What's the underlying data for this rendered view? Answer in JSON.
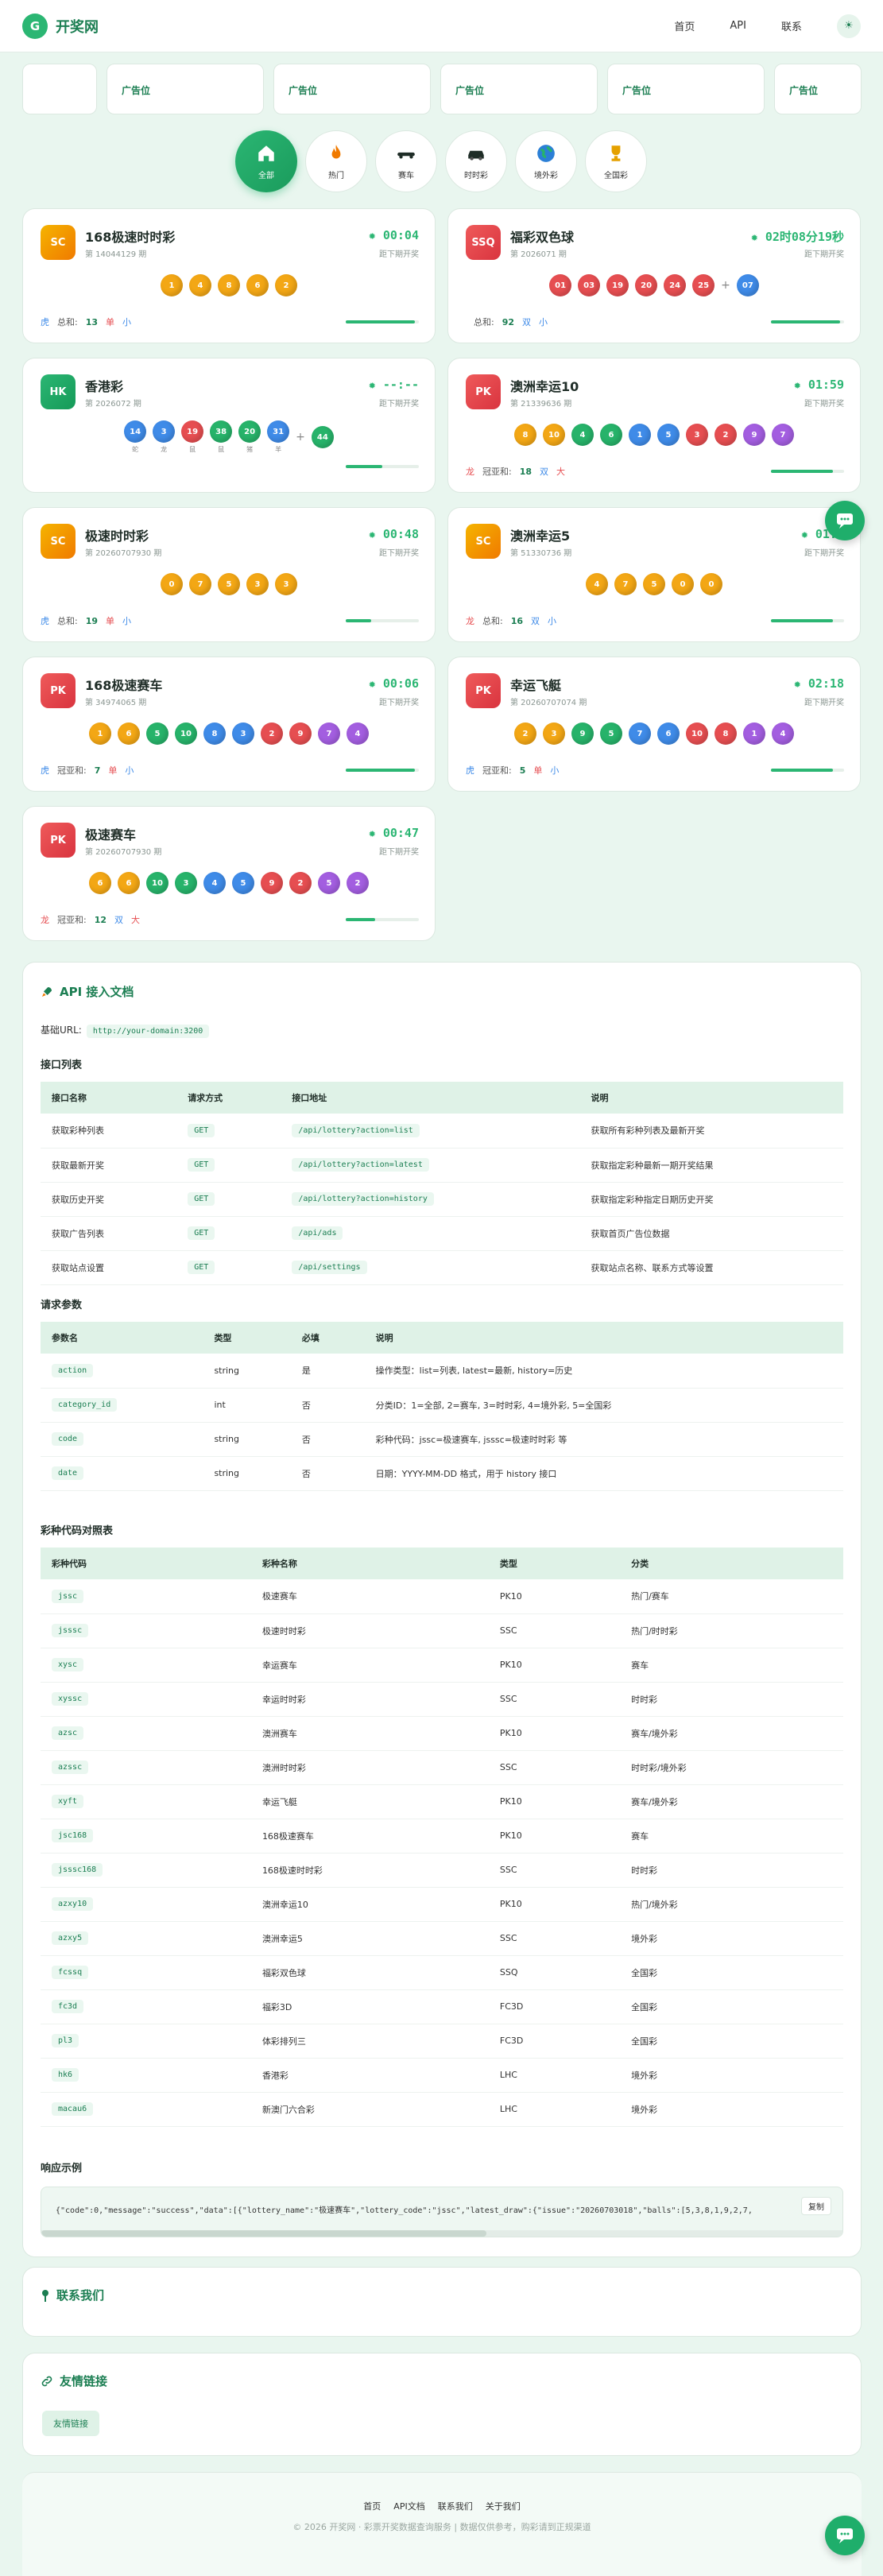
{
  "header": {
    "logo_letter": "G",
    "title": "开奖网",
    "nav": [
      "首页",
      "API",
      "联系"
    ],
    "theme_icon": "☀"
  },
  "ads": [
    "",
    "广告位",
    "广告位",
    "广告位",
    "广告位",
    "广告位"
  ],
  "categories": [
    {
      "label": "全部",
      "icon": "home-icon"
    },
    {
      "label": "热门",
      "icon": "fire-icon"
    },
    {
      "label": "赛车",
      "icon": "race-car-icon"
    },
    {
      "label": "时时彩",
      "icon": "car-icon"
    },
    {
      "label": "境外彩",
      "icon": "globe-icon"
    },
    {
      "label": "全国彩",
      "icon": "trophy-icon"
    }
  ],
  "cards": [
    {
      "badge": "SC",
      "name": "168极速时时彩",
      "issue": "第 14044129 期",
      "timer": "00:04",
      "sub": "距下期开奖",
      "balls": [
        "1",
        "4",
        "8",
        "6",
        "2"
      ],
      "colors": [
        "bo",
        "bo",
        "bo",
        "bo",
        "bo"
      ],
      "f1": "虎",
      "f2": "总和:",
      "f3": "13",
      "f4": "单",
      "f5": "小",
      "progress": 0.95
    },
    {
      "badge": "SSQ",
      "name": "福彩双色球",
      "issue": "第 2026071 期",
      "timer": "02时08分19秒",
      "sub": "距下期开奖",
      "balls": [
        "01",
        "03",
        "19",
        "20",
        "24",
        "25",
        "+",
        "07"
      ],
      "colors": [
        "br",
        "br",
        "br",
        "br",
        "br",
        "br",
        "",
        "bb"
      ],
      "f1": "",
      "f2": "总和:",
      "f3": "92",
      "f4": "双",
      "f5": "小",
      "progress": 0.95
    },
    {
      "badge": "HK",
      "name": "香港彩",
      "issue": "第 2026072 期",
      "timer": "--:--",
      "sub": "距下期开奖",
      "balls": [
        "14",
        "3",
        "19",
        "38",
        "20",
        "31",
        "+",
        "44"
      ],
      "colors": [
        "bb",
        "bb",
        "br",
        "bg",
        "bg",
        "bb",
        "",
        "bg"
      ],
      "zodiac": [
        "蛇",
        "龙",
        "鼠",
        "鼠",
        "猪",
        "羊"
      ],
      "progress": 0.5
    },
    {
      "badge": "PK",
      "name": "澳洲幸运10",
      "issue": "第 21339636 期",
      "timer": "01:59",
      "sub": "距下期开奖",
      "balls": [
        "8",
        "10",
        "4",
        "6",
        "1",
        "5",
        "3",
        "2",
        "9",
        "7"
      ],
      "colors": [
        "bo",
        "bo",
        "bg",
        "bg",
        "bb",
        "bb",
        "br",
        "br",
        "bp",
        "bp"
      ],
      "f1": "龙",
      "f2": "冠亚和:",
      "f3": "18",
      "f4": "双",
      "f5": "大",
      "progress": 0.85
    },
    {
      "badge": "SC",
      "name": "极速时时彩",
      "issue": "第 20260707930 期",
      "timer": "00:48",
      "sub": "距下期开奖",
      "balls": [
        "0",
        "7",
        "5",
        "3",
        "3"
      ],
      "colors": [
        "bo",
        "bo",
        "bo",
        "bo",
        "bo"
      ],
      "f1": "虎",
      "f2": "总和:",
      "f3": "19",
      "f4": "单",
      "f5": "小",
      "progress": 0.35
    },
    {
      "badge": "SC",
      "name": "澳洲幸运5",
      "issue": "第 51330736 期",
      "timer": "01:0",
      "sub": "距下期开奖",
      "balls": [
        "4",
        "7",
        "5",
        "0",
        "0"
      ],
      "colors": [
        "bo",
        "bo",
        "bo",
        "bo",
        "bo"
      ],
      "f1": "龙",
      "f2": "总和:",
      "f3": "16",
      "f4": "双",
      "f5": "小",
      "progress": 0.85
    },
    {
      "badge": "PK",
      "name": "168极速赛车",
      "issue": "第 34974065 期",
      "timer": "00:06",
      "sub": "距下期开奖",
      "balls": [
        "1",
        "6",
        "5",
        "10",
        "8",
        "3",
        "2",
        "9",
        "7",
        "4"
      ],
      "colors": [
        "bo",
        "bo",
        "bg",
        "bg",
        "bb",
        "bb",
        "br",
        "br",
        "bp",
        "bp"
      ],
      "f1": "虎",
      "f2": "冠亚和:",
      "f3": "7",
      "f4": "单",
      "f5": "小",
      "progress": 0.95
    },
    {
      "badge": "PK",
      "name": "幸运飞艇",
      "issue": "第 20260707074 期",
      "timer": "02:18",
      "sub": "距下期开奖",
      "balls": [
        "2",
        "3",
        "9",
        "5",
        "7",
        "6",
        "10",
        "8",
        "1",
        "4"
      ],
      "colors": [
        "bo",
        "bo",
        "bg",
        "bg",
        "bb",
        "bb",
        "br",
        "br",
        "bp",
        "bp"
      ],
      "f1": "虎",
      "f2": "冠亚和:",
      "f3": "5",
      "f4": "单",
      "f5": "小",
      "progress": 0.85
    },
    {
      "badge": "PK",
      "name": "极速赛车",
      "issue": "第 20260707930 期",
      "timer": "00:47",
      "sub": "距下期开奖",
      "balls": [
        "6",
        "6",
        "10",
        "3",
        "4",
        "5",
        "9",
        "2",
        "5",
        "2"
      ],
      "colors": [
        "bo",
        "bo",
        "bg",
        "bg",
        "bb",
        "bb",
        "br",
        "br",
        "bp",
        "bp"
      ],
      "f1": "龙",
      "f2": "冠亚和:",
      "f3": "12",
      "f4": "双",
      "f5": "大",
      "progress": 0.4
    }
  ],
  "api": {
    "title": "API 接入文档",
    "base_label": "基础URL:",
    "base_url": "http://your-domain:3200",
    "list_title": "接口列表",
    "endpoints_headers": [
      "接口名称",
      "请求方式",
      "接口地址",
      "说明"
    ],
    "endpoints": [
      [
        "获取彩种列表",
        "GET",
        "/api/lottery?action=list",
        "获取所有彩种列表及最新开奖"
      ],
      [
        "获取最新开奖",
        "GET",
        "/api/lottery?action=latest",
        "获取指定彩种最新一期开奖结果"
      ],
      [
        "获取历史开奖",
        "GET",
        "/api/lottery?action=history",
        "获取指定彩种指定日期历史开奖"
      ],
      [
        "获取广告列表",
        "GET",
        "/api/ads",
        "获取首页广告位数据"
      ],
      [
        "获取站点设置",
        "GET",
        "/api/settings",
        "获取站点名称、联系方式等设置"
      ]
    ],
    "params_title": "请求参数",
    "params_headers": [
      "参数名",
      "类型",
      "必填",
      "说明"
    ],
    "params": [
      [
        "action",
        "string",
        "是",
        "操作类型：list=列表, latest=最新, history=历史"
      ],
      [
        "category_id",
        "int",
        "否",
        "分类ID：1=全部, 2=赛车, 3=时时彩, 4=境外彩, 5=全国彩"
      ],
      [
        "code",
        "string",
        "否",
        "彩种代码：jssc=极速赛车, jsssc=极速时时彩 等"
      ],
      [
        "date",
        "string",
        "否",
        "日期：YYYY-MM-DD 格式，用于 history 接口"
      ]
    ],
    "codes_title": "彩种代码对照表",
    "codes_headers": [
      "彩种代码",
      "彩种名称",
      "类型",
      "分类"
    ],
    "codes": [
      [
        "jssc",
        "极速赛车",
        "PK10",
        "热门/赛车"
      ],
      [
        "jsssc",
        "极速时时彩",
        "SSC",
        "热门/时时彩"
      ],
      [
        "xysc",
        "幸运赛车",
        "PK10",
        "赛车"
      ],
      [
        "xyssc",
        "幸运时时彩",
        "SSC",
        "时时彩"
      ],
      [
        "azsc",
        "澳洲赛车",
        "PK10",
        "赛车/境外彩"
      ],
      [
        "azssc",
        "澳洲时时彩",
        "SSC",
        "时时彩/境外彩"
      ],
      [
        "xyft",
        "幸运飞艇",
        "PK10",
        "赛车/境外彩"
      ],
      [
        "jsc168",
        "168极速赛车",
        "PK10",
        "赛车"
      ],
      [
        "jsssc168",
        "168极速时时彩",
        "SSC",
        "时时彩"
      ],
      [
        "azxy10",
        "澳洲幸运10",
        "PK10",
        "热门/境外彩"
      ],
      [
        "azxy5",
        "澳洲幸运5",
        "SSC",
        "境外彩"
      ],
      [
        "fcssq",
        "福彩双色球",
        "SSQ",
        "全国彩"
      ],
      [
        "fc3d",
        "福彩3D",
        "FC3D",
        "全国彩"
      ],
      [
        "pl3",
        "体彩排列三",
        "FC3D",
        "全国彩"
      ],
      [
        "hk6",
        "香港彩",
        "LHC",
        "境外彩"
      ],
      [
        "macau6",
        "新澳门六合彩",
        "LHC",
        "境外彩"
      ]
    ],
    "resp_title": "响应示例",
    "resp": "{\"code\":0,\"message\":\"success\",\"data\":[{\"lottery_name\":\"极速赛车\",\"lottery_code\":\"jssc\",\"latest_draw\":{\"issue\":\"20260703018\",\"balls\":[5,3,8,1,9,2,7,",
    "copy": "复制"
  },
  "contact": {
    "title": "联系我们"
  },
  "links": {
    "title": "友情链接",
    "btn": "友情链接"
  },
  "footer": {
    "links": [
      "首页",
      "API文档",
      "联系我们",
      "关于我们"
    ],
    "copyright": "© 2026 开奖网 · 彩票开奖数据查询服务 | 数据仅供参考，购彩请到正规渠道"
  },
  "colors": {
    "accent": "#2bb673",
    "dark_accent": "#1b7e52",
    "background": "#e9f6ef"
  }
}
